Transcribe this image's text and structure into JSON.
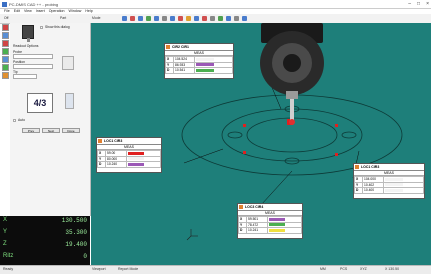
{
  "window": {
    "title": "PC-DMIS CAD ++ - probing"
  },
  "menu": [
    "File",
    "Edit",
    "View",
    "Insert",
    "Operation",
    "Window",
    "Help"
  ],
  "toolbar": {
    "labels": [
      "Off",
      "Part",
      "Mode"
    ]
  },
  "left_panel": {
    "checkbox_label": "Show this dialog",
    "group_label": "Readout Options",
    "field1": "Probe",
    "field2": "Position",
    "field3": "Tip",
    "fraction": "4/3",
    "option_label": "Auto",
    "buttons": [
      "Prev",
      "Next",
      "Done"
    ]
  },
  "dro": {
    "rows": [
      {
        "axis": "X",
        "value": "130.500"
      },
      {
        "axis": "Y",
        "value": "35.300"
      },
      {
        "axis": "Z",
        "value": "19.400"
      },
      {
        "axis": "Ritz",
        "value": "0"
      }
    ]
  },
  "callouts": [
    {
      "id": "ci2",
      "title": "CIR2 CIR1",
      "sub": "MEAS",
      "rows": [
        {
          "axis": "X",
          "value": "104.524"
        },
        {
          "axis": "Y",
          "value": "86.933"
        },
        {
          "axis": "D",
          "value": "10.541"
        }
      ],
      "colors": [
        "#f4f4f4",
        "#9b59b6",
        "#4caf50"
      ]
    },
    {
      "id": "loc1",
      "title": "LOC1 CIR3",
      "sub": "MEAS",
      "rows": [
        {
          "axis": "X",
          "value": "59.00"
        },
        {
          "axis": "Y",
          "value": "80.000"
        },
        {
          "axis": "D",
          "value": "10.240"
        }
      ],
      "colors": [
        "#e02020",
        "#f4f4f4",
        "#9b59b6"
      ]
    },
    {
      "id": "loc2",
      "title": "LOC1 CIR3",
      "sub": "MEAS",
      "rows": [
        {
          "axis": "X",
          "value": "104.000"
        },
        {
          "axis": "Y",
          "value": "10.402"
        },
        {
          "axis": "D",
          "value": "10.400"
        }
      ],
      "colors": [
        "#f4f4f4",
        "#f4f4f4",
        "#f4f4f4"
      ]
    },
    {
      "id": "loc3",
      "title": "LOC3 CIR4",
      "sub": "MEAS",
      "rows": [
        {
          "axis": "X",
          "value": "59.501"
        },
        {
          "axis": "Y",
          "value": "78.472"
        },
        {
          "axis": "D",
          "value": "10.241"
        }
      ],
      "colors": [
        "#9b59b6",
        "#4caf50",
        "#f0e040"
      ]
    }
  ],
  "statusbar": {
    "left": "Ready",
    "tabs": [
      "Viewport",
      "Report Mode"
    ],
    "right": [
      "MM",
      "PCS",
      "XYZ",
      "X 130.50"
    ]
  },
  "accent": {
    "viewport_bg": "#1e7f7a",
    "dro_bg": "#0c0c0c",
    "dro_text": "#9ef09e"
  }
}
